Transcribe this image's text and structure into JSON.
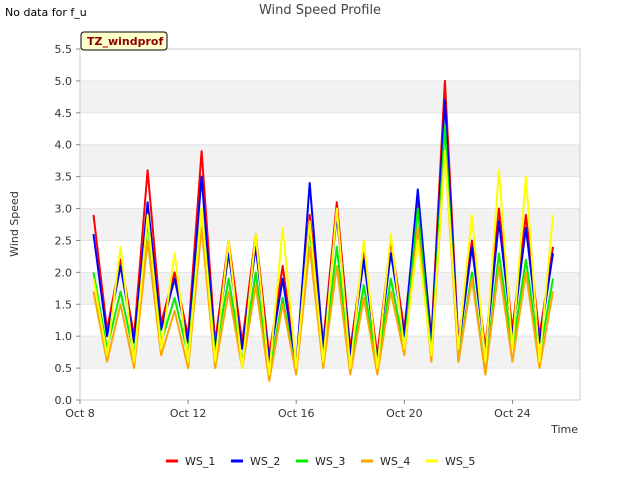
{
  "status_note": "No data for f_u",
  "chart_data": {
    "type": "line",
    "title": "Wind Speed Profile",
    "xlabel": "Time",
    "ylabel": "Wind Speed",
    "badge": "TZ_windprof",
    "ylim": [
      0,
      5.5
    ],
    "yticks": [
      0.0,
      0.5,
      1.0,
      1.5,
      2.0,
      2.5,
      3.0,
      3.5,
      4.0,
      4.5,
      5.0,
      5.5
    ],
    "ytick_labels": [
      "0.0",
      "0.5",
      "1.0",
      "1.5",
      "2.0",
      "2.5",
      "3.0",
      "3.5",
      "4.0",
      "4.5",
      "5.0",
      "5.5"
    ],
    "xlim": [
      "2015-10-08",
      "2015-10-26T12:00"
    ],
    "xticks": [
      "2015-10-08",
      "2015-10-12",
      "2015-10-16",
      "2015-10-20",
      "2015-10-24"
    ],
    "xtick_labels": [
      "Oct 8",
      "Oct 12",
      "Oct 16",
      "Oct 20",
      "Oct 24"
    ],
    "grid": "horizontal bands",
    "legend_position": "bottom",
    "x": [
      "2015-10-08T12:00",
      "2015-10-09T00:00",
      "2015-10-09T12:00",
      "2015-10-10T00:00",
      "2015-10-10T12:00",
      "2015-10-11T00:00",
      "2015-10-11T12:00",
      "2015-10-12T00:00",
      "2015-10-12T12:00",
      "2015-10-13T00:00",
      "2015-10-13T12:00",
      "2015-10-14T00:00",
      "2015-10-14T12:00",
      "2015-10-15T00:00",
      "2015-10-15T12:00",
      "2015-10-16T00:00",
      "2015-10-16T12:00",
      "2015-10-17T00:00",
      "2015-10-17T12:00",
      "2015-10-18T00:00",
      "2015-10-18T12:00",
      "2015-10-19T00:00",
      "2015-10-19T12:00",
      "2015-10-20T00:00",
      "2015-10-20T12:00",
      "2015-10-21T00:00",
      "2015-10-21T12:00",
      "2015-10-22T00:00",
      "2015-10-22T12:00",
      "2015-10-23T00:00",
      "2015-10-23T12:00",
      "2015-10-24T00:00",
      "2015-10-24T12:00",
      "2015-10-25T00:00",
      "2015-10-25T12:00"
    ],
    "series": [
      {
        "name": "WS_1",
        "color": "#ff0000",
        "values": [
          2.9,
          1.1,
          2.2,
          1.0,
          3.6,
          1.2,
          2.0,
          1.0,
          3.9,
          0.9,
          2.5,
          0.9,
          2.6,
          0.7,
          2.1,
          0.5,
          2.9,
          0.9,
          3.1,
          0.8,
          2.3,
          0.7,
          2.5,
          1.1,
          3.1,
          1.0,
          5.0,
          0.9,
          2.5,
          0.8,
          3.0,
          1.1,
          2.9,
          1.0,
          2.4
        ]
      },
      {
        "name": "WS_2",
        "color": "#0000ff",
        "values": [
          2.6,
          1.0,
          2.1,
          0.9,
          3.1,
          1.1,
          1.9,
          0.9,
          3.5,
          0.8,
          2.3,
          0.8,
          2.4,
          0.6,
          1.9,
          0.5,
          3.4,
          0.8,
          2.9,
          0.7,
          2.2,
          0.6,
          2.3,
          1.0,
          3.3,
          0.9,
          4.7,
          0.8,
          2.4,
          0.7,
          2.8,
          1.0,
          2.7,
          0.9,
          2.3
        ]
      },
      {
        "name": "WS_3",
        "color": "#00ee00",
        "values": [
          2.0,
          0.8,
          1.7,
          0.7,
          2.8,
          0.9,
          1.6,
          0.7,
          3.0,
          0.7,
          1.9,
          0.6,
          2.0,
          0.4,
          1.6,
          0.4,
          2.7,
          0.6,
          2.4,
          0.5,
          1.8,
          0.5,
          1.9,
          0.8,
          3.0,
          0.7,
          4.3,
          0.6,
          2.0,
          0.4,
          2.3,
          0.8,
          2.2,
          0.7,
          1.9
        ]
      },
      {
        "name": "WS_4",
        "color": "#ffa500",
        "values": [
          1.7,
          0.6,
          1.5,
          0.5,
          2.5,
          0.7,
          1.4,
          0.5,
          2.7,
          0.5,
          1.7,
          0.5,
          1.8,
          0.3,
          1.5,
          0.4,
          2.4,
          0.5,
          2.1,
          0.4,
          1.6,
          0.4,
          1.7,
          0.7,
          2.7,
          0.6,
          3.9,
          0.6,
          1.9,
          0.4,
          2.1,
          0.6,
          2.0,
          0.5,
          1.7
        ]
      },
      {
        "name": "WS_5",
        "color": "#ffff00",
        "values": [
          1.9,
          0.7,
          2.4,
          0.6,
          2.9,
          0.8,
          2.3,
          0.6,
          3.0,
          0.6,
          2.5,
          0.5,
          2.6,
          0.4,
          2.7,
          0.5,
          2.8,
          0.6,
          3.0,
          0.5,
          2.5,
          0.5,
          2.6,
          0.8,
          2.5,
          0.7,
          3.9,
          0.8,
          2.9,
          0.6,
          3.6,
          0.8,
          3.5,
          0.6,
          2.9
        ]
      }
    ]
  }
}
